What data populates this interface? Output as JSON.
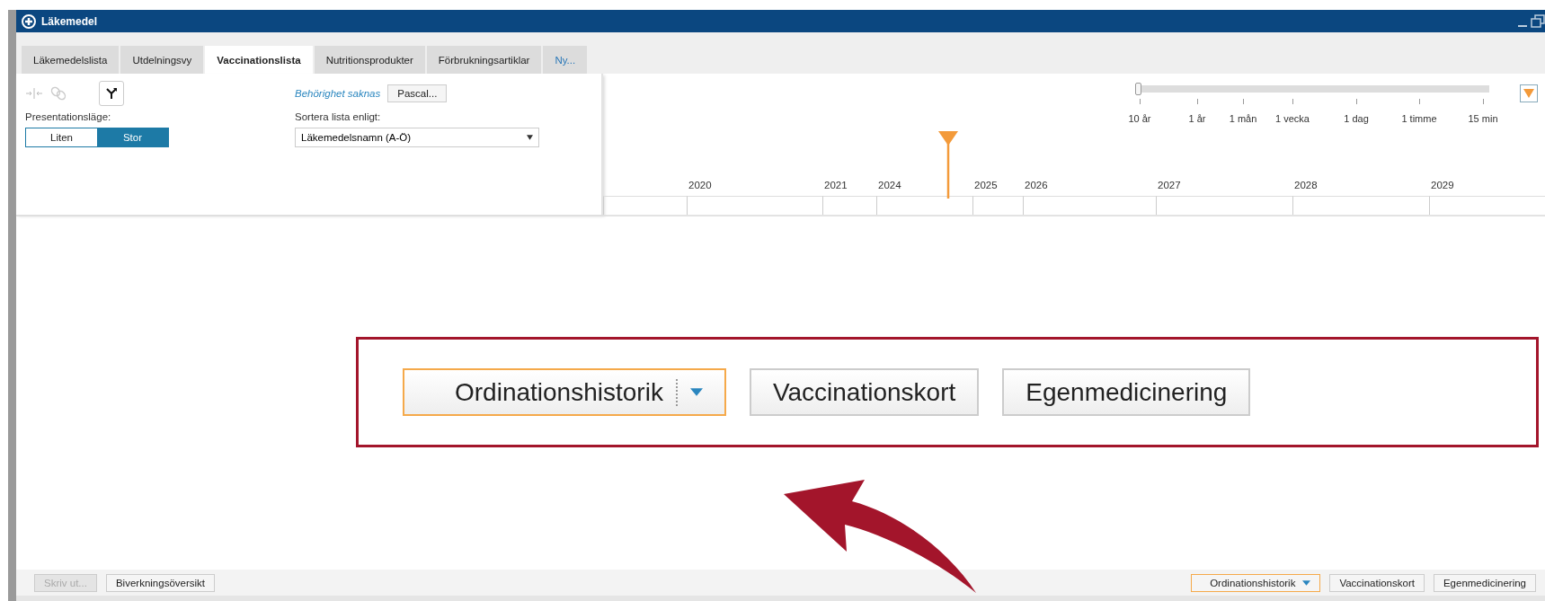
{
  "window": {
    "title": "Läkemedel"
  },
  "tabs": [
    {
      "label": "Läkemedelslista",
      "selected": false,
      "kind": "tab"
    },
    {
      "label": "Utdelningsvy",
      "selected": false,
      "kind": "tab"
    },
    {
      "label": "Vaccinationslista",
      "selected": true,
      "kind": "tab"
    },
    {
      "label": "Nutritionsprodukter",
      "selected": false,
      "kind": "tab"
    },
    {
      "label": "Förbrukningsartiklar",
      "selected": false,
      "kind": "tab"
    },
    {
      "label": "Ny...",
      "selected": false,
      "kind": "new"
    }
  ],
  "toolbar": {
    "permission_note": "Behörighet saknas",
    "user_button": "Pascal...",
    "presentation_label": "Presentationsläge:",
    "presentation_modes": [
      {
        "label": "Liten",
        "selected": false
      },
      {
        "label": "Stor",
        "selected": true
      }
    ],
    "sort_label": "Sortera lista enligt:",
    "sort_value": "Läkemedelsnamn (A-Ö)"
  },
  "timeline": {
    "zoom": {
      "level": 0,
      "labels": [
        "10 år",
        "1 år",
        "1 mån",
        "1 vecka",
        "1 dag",
        "1 timme",
        "15 min"
      ]
    },
    "years": [
      "2020",
      "2021",
      "2024",
      "2025",
      "2026",
      "2027",
      "2028",
      "2029"
    ]
  },
  "callout": {
    "buttons": [
      {
        "label": "Ordinationshistorik",
        "highlighted": true,
        "dropdown": true
      },
      {
        "label": "Vaccinationskort",
        "highlighted": false,
        "dropdown": false
      },
      {
        "label": "Egenmedicinering",
        "highlighted": false,
        "dropdown": false
      }
    ]
  },
  "bottom_bar": {
    "left_buttons": [
      {
        "label": "Skriv ut...",
        "disabled": true
      },
      {
        "label": "Biverkningsöversikt",
        "disabled": false
      }
    ],
    "right_buttons": [
      {
        "label": "Ordinationshistorik",
        "highlighted": true,
        "dropdown": true
      },
      {
        "label": "Vaccinationskort",
        "highlighted": false,
        "dropdown": false
      },
      {
        "label": "Egenmedicinering",
        "highlighted": false,
        "dropdown": false
      }
    ]
  }
}
